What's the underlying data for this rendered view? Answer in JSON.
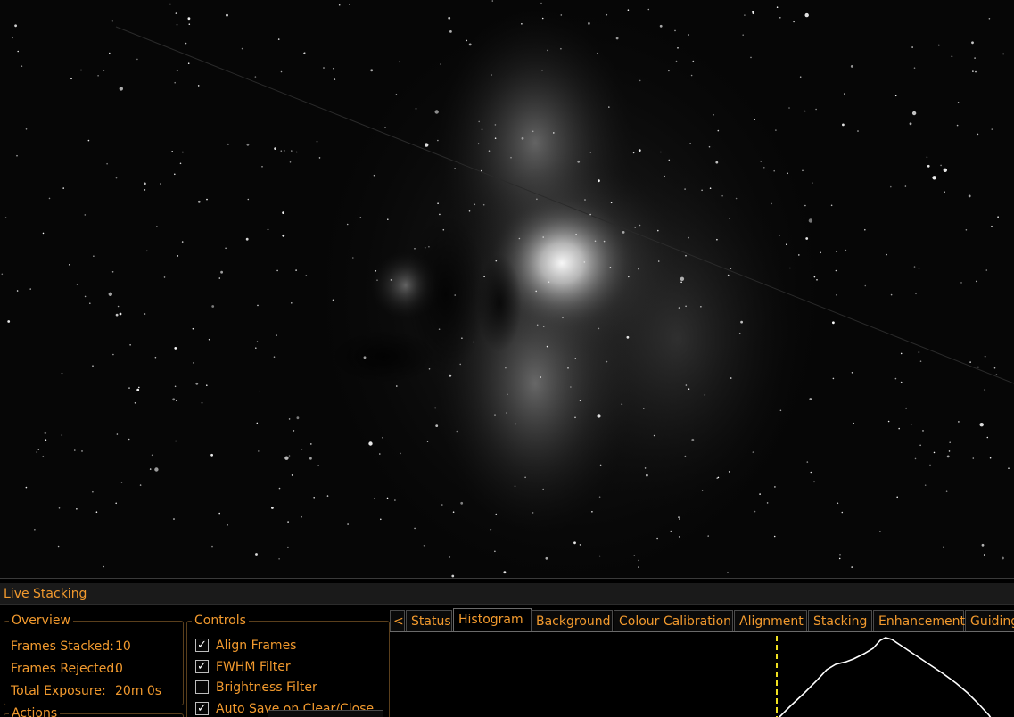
{
  "panel": {
    "title": "Live Stacking"
  },
  "overview": {
    "legend": "Overview",
    "frames_stacked_label": "Frames Stacked:",
    "frames_stacked_value": "10",
    "frames_rejected_label": "Frames Rejected:",
    "frames_rejected_value": "0",
    "total_exposure_label": "Total Exposure:",
    "total_exposure_value": "20m 0s"
  },
  "actions": {
    "legend": "Actions"
  },
  "controls": {
    "legend": "Controls",
    "items": [
      {
        "label": "Align Frames",
        "checked": true
      },
      {
        "label": "FWHM Filter",
        "checked": true
      },
      {
        "label": "Brightness Filter",
        "checked": false
      },
      {
        "label": "Auto Save on Clear/Close",
        "checked": true
      }
    ]
  },
  "tabs": {
    "scroll_left": "<",
    "items": [
      "Status",
      "Histogram",
      "Background",
      "Colour Calibration",
      "Alignment",
      "Stacking",
      "Enhancement",
      "Guiding"
    ],
    "active": "Histogram"
  },
  "colors": {
    "accent": "#f29a2e",
    "marker": "#f0e020",
    "curve": "#ffffff"
  },
  "icons": {
    "checkmark": "checkmark-icon"
  }
}
